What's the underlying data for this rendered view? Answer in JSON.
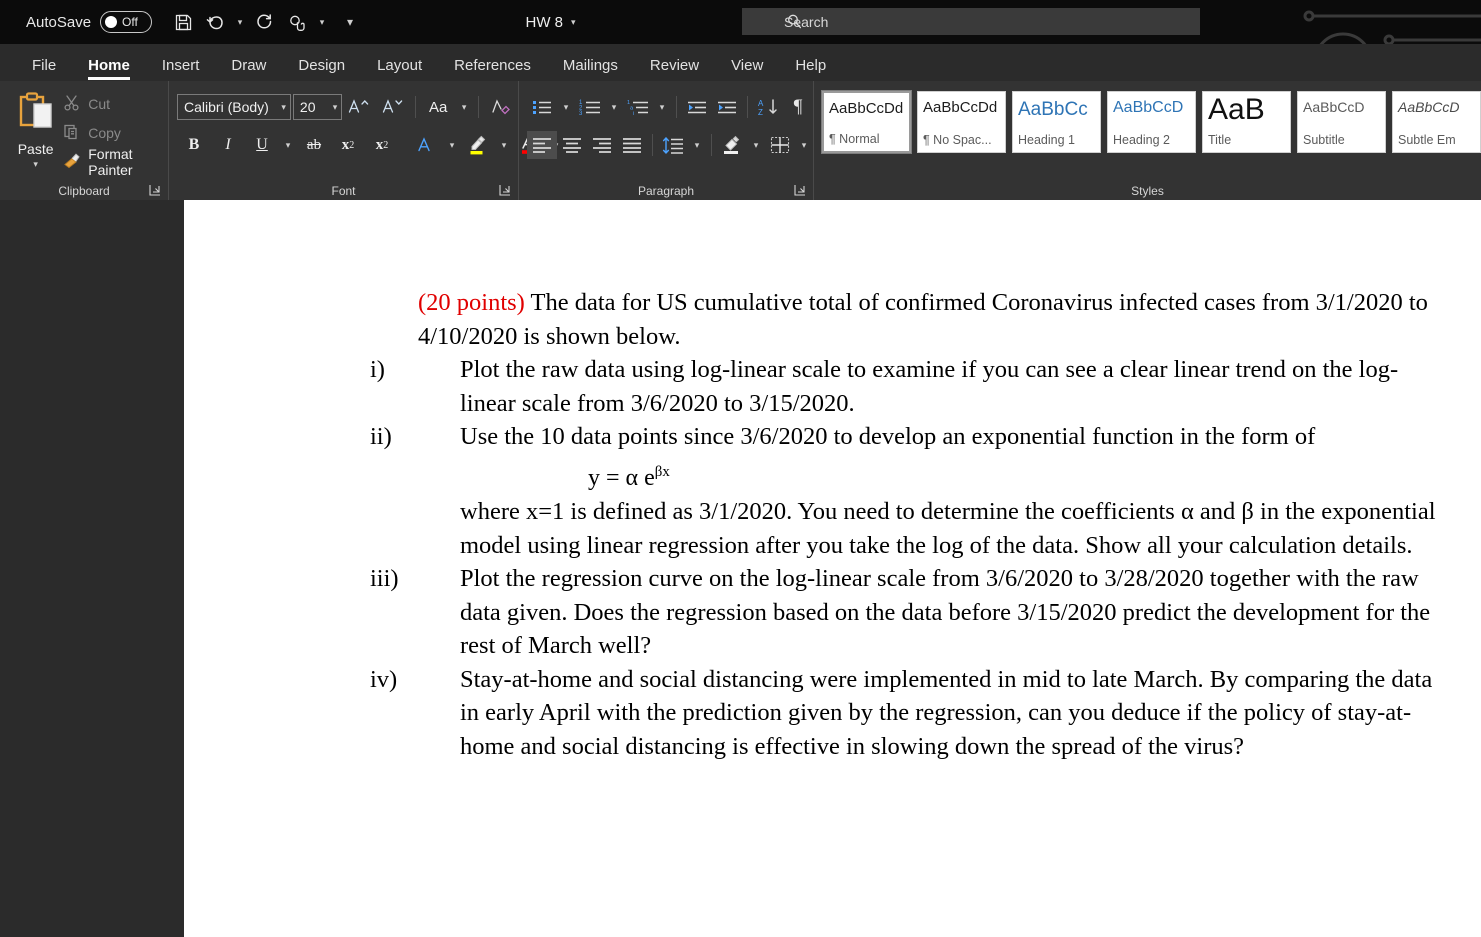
{
  "titlebar": {
    "autosave_label": "AutoSave",
    "autosave_state": "Off",
    "save_icon": "save-icon",
    "undo_icon": "undo-icon",
    "redo_icon": "redo-icon",
    "touch_mode_icon": "touch-mode-icon",
    "customize_qat_icon": "customize-quick-access-toolbar-icon",
    "document_title": "HW 8",
    "title_caret_icon": "chevron-down-icon",
    "search_icon": "search-icon",
    "search_placeholder": "Search",
    "search_value": ""
  },
  "tabs": [
    {
      "label": "File",
      "active": false
    },
    {
      "label": "Home",
      "active": true
    },
    {
      "label": "Insert",
      "active": false
    },
    {
      "label": "Draw",
      "active": false
    },
    {
      "label": "Design",
      "active": false
    },
    {
      "label": "Layout",
      "active": false
    },
    {
      "label": "References",
      "active": false
    },
    {
      "label": "Mailings",
      "active": false
    },
    {
      "label": "Review",
      "active": false
    },
    {
      "label": "View",
      "active": false
    },
    {
      "label": "Help",
      "active": false
    }
  ],
  "ribbon": {
    "clipboard": {
      "group_label": "Clipboard",
      "paste_label": "Paste",
      "paste_caret_icon": "chevron-down-icon",
      "paste_icon": "clipboard-paste-icon",
      "cut_label": "Cut",
      "cut_icon": "scissors-icon",
      "cut_disabled": true,
      "copy_label": "Copy",
      "copy_icon": "copy-icon",
      "copy_disabled": true,
      "format_painter_label": "Format Painter",
      "format_painter_icon": "paintbrush-icon",
      "dialog_launcher_icon": "dialog-launcher-icon"
    },
    "font": {
      "group_label": "Font",
      "font_family_value": "Calibri (Body)",
      "font_size_value": "20",
      "grow_font_icon": "grow-font-icon",
      "shrink_font_icon": "shrink-font-icon",
      "change_case_label": "Aa",
      "change_case_icon": "change-case-icon",
      "clear_formatting_icon": "clear-formatting-icon",
      "bold_label": "B",
      "italic_label": "I",
      "underline_label": "U",
      "strikethrough_label": "ab",
      "subscript_label": "x",
      "subscript_sub": "2",
      "superscript_label": "x",
      "superscript_sup": "2",
      "text_effects_icon": "text-effects-icon",
      "highlight_icon": "text-highlight-icon",
      "highlight_color": "#ffff00",
      "font_color_icon": "font-color-icon",
      "font_color": "#ff0000",
      "dialog_launcher_icon": "dialog-launcher-icon"
    },
    "paragraph": {
      "group_label": "Paragraph",
      "bullets_icon": "bullets-icon",
      "numbering_icon": "numbering-icon",
      "multilevel_list_icon": "multilevel-list-icon",
      "decrease_indent_icon": "decrease-indent-icon",
      "increase_indent_icon": "increase-indent-icon",
      "sort_icon": "sort-az-icon",
      "show_marks_icon": "show-formatting-marks-icon",
      "align_left_icon": "align-left-icon",
      "align_center_icon": "align-center-icon",
      "align_right_icon": "align-right-icon",
      "justify_icon": "justify-icon",
      "line_spacing_icon": "line-spacing-icon",
      "shading_icon": "shading-icon",
      "borders_icon": "borders-icon",
      "dialog_launcher_icon": "dialog-launcher-icon",
      "active_alignment": "align-left"
    },
    "styles": {
      "group_label": "Styles",
      "items": [
        {
          "sample": "AaBbCcDd",
          "name": "¶ Normal",
          "selected": true,
          "variant": "normal"
        },
        {
          "sample": "AaBbCcDd",
          "name": "¶ No Spac...",
          "selected": false,
          "variant": "normal"
        },
        {
          "sample": "AaBbCс",
          "name": "Heading 1",
          "selected": false,
          "variant": "blue"
        },
        {
          "sample": "AaBbCcD",
          "name": "Heading 2",
          "selected": false,
          "variant": "blue2"
        },
        {
          "sample": "AaB",
          "name": "Title",
          "selected": false,
          "variant": "title"
        },
        {
          "sample": "AaBbCcD",
          "name": "Subtitle",
          "selected": false,
          "variant": "sub"
        },
        {
          "sample": "AaBbCcD",
          "name": "Subtle Em",
          "selected": false,
          "variant": "subem"
        }
      ]
    }
  },
  "document": {
    "intro": {
      "points": "(20 points)",
      "text": " The data for US cumulative total of confirmed Coronavirus infected cases from 3/1/2020 to 4/10/2020 is shown below."
    },
    "items": [
      {
        "marker": "i)",
        "text": "Plot the raw data using log-linear scale to examine if you can see a clear linear trend on the log-linear scale from 3/6/2020 to 3/15/2020."
      },
      {
        "marker": "ii)",
        "text": "Use the 10 data points since 3/6/2020 to develop an exponential function in the form of",
        "equation_base": "y = α e",
        "equation_exponent": "βx",
        "text_after": "where x=1 is defined as 3/1/2020. You need to determine the coefficients α and β in the exponential model using linear regression after you take the log of the data. Show all your calculation details."
      },
      {
        "marker": "iii)",
        "text": "Plot the regression curve on the log-linear scale from 3/6/2020 to 3/28/2020 together with the raw data given. Does the regression based on the data before 3/15/2020 predict the development for the rest of March well?"
      },
      {
        "marker": "iv)",
        "text": "Stay-at-home and social distancing were implemented in mid to late March. By comparing the data in early April with the prediction given by the regression, can you deduce if the policy of stay-at-home and social distancing is effective in slowing down the spread of the virus?"
      }
    ]
  },
  "colors": {
    "titlebar_bg": "#0b0b0b",
    "ribbon_bg": "#333333",
    "tabs_bg": "#2b2b2b",
    "workspace_bg": "#2b2b2b",
    "page_bg": "#ffffff",
    "accent_red": "#e00000",
    "heading_blue": "#2e74b5"
  }
}
